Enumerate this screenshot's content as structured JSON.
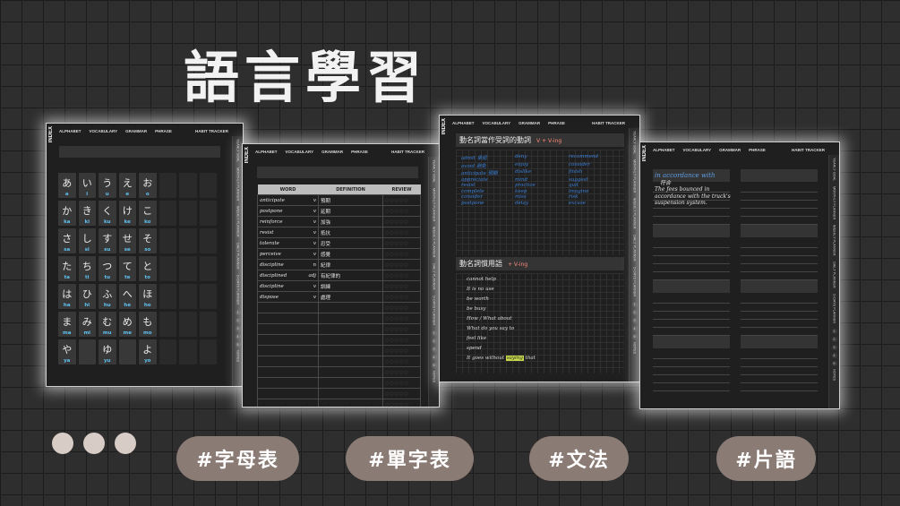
{
  "title": "語言學習",
  "nav": {
    "items": [
      "ALPHABET",
      "VOCABULARY",
      "GRAMMAR",
      "PHRASE"
    ],
    "tracker": "HABIT TRACKER",
    "index": "INDEX"
  },
  "sidetabs": [
    "YEARLY GOAL",
    "MONTHLY PLANNER",
    "WEEKLY PLANNER",
    "DAILY PLANNER",
    "D-DAYS PLANNER"
  ],
  "sidetab_numbers": [
    "1",
    "2",
    "3",
    "4",
    "5"
  ],
  "sidetab_notes": "NOTES",
  "kana": [
    [
      {
        "k": "あ",
        "r": "a"
      },
      {
        "k": "い",
        "r": "i"
      },
      {
        "k": "う",
        "r": "u"
      },
      {
        "k": "え",
        "r": "e"
      },
      {
        "k": "お",
        "r": "o"
      }
    ],
    [
      {
        "k": "か",
        "r": "ka"
      },
      {
        "k": "き",
        "r": "ki"
      },
      {
        "k": "く",
        "r": "ku"
      },
      {
        "k": "け",
        "r": "ke"
      },
      {
        "k": "こ",
        "r": "ko"
      }
    ],
    [
      {
        "k": "さ",
        "r": "sa"
      },
      {
        "k": "し",
        "r": "si"
      },
      {
        "k": "す",
        "r": "su"
      },
      {
        "k": "せ",
        "r": "se"
      },
      {
        "k": "そ",
        "r": "so"
      }
    ],
    [
      {
        "k": "た",
        "r": "ta"
      },
      {
        "k": "ち",
        "r": "ti"
      },
      {
        "k": "つ",
        "r": "tu"
      },
      {
        "k": "て",
        "r": "te"
      },
      {
        "k": "と",
        "r": "to"
      }
    ],
    [
      {
        "k": "は",
        "r": "ha"
      },
      {
        "k": "ひ",
        "r": "hi"
      },
      {
        "k": "ふ",
        "r": "hu"
      },
      {
        "k": "へ",
        "r": "he"
      },
      {
        "k": "ほ",
        "r": "ho"
      }
    ],
    [
      {
        "k": "ま",
        "r": "ma"
      },
      {
        "k": "み",
        "r": "mi"
      },
      {
        "k": "む",
        "r": "mu"
      },
      {
        "k": "め",
        "r": "me"
      },
      {
        "k": "も",
        "r": "mo"
      }
    ],
    [
      {
        "k": "や",
        "r": "ya"
      },
      {
        "k": "",
        "r": ""
      },
      {
        "k": "ゆ",
        "r": "yu"
      },
      {
        "k": "",
        "r": ""
      },
      {
        "k": "よ",
        "r": "yo"
      }
    ]
  ],
  "vocab": {
    "headers": [
      "WORD",
      "DEFINITION",
      "REVIEW"
    ],
    "rows": [
      {
        "word": "anticipate",
        "pos": "v",
        "def": "預期"
      },
      {
        "word": "postpone",
        "pos": "v",
        "def": "延期"
      },
      {
        "word": "reinforce",
        "pos": "v",
        "def": "加強"
      },
      {
        "word": "resist",
        "pos": "v",
        "def": "抵抗"
      },
      {
        "word": "tolerate",
        "pos": "v",
        "def": "忍受"
      },
      {
        "word": "perceive",
        "pos": "v",
        "def": "感覺"
      },
      {
        "word": "discipline",
        "pos": "n",
        "def": "紀律"
      },
      {
        "word": "disciplined",
        "pos": "adj",
        "def": "有紀律的"
      },
      {
        "word": "discipline",
        "pos": "v",
        "def": "訓練"
      },
      {
        "word": "dispose",
        "pos": "v",
        "def": "處理"
      }
    ]
  },
  "grammar": {
    "heading1": "動名詞當作受詞的動詞",
    "heading1_accent": "V + V-ing",
    "heading2": "動名詞慣用語",
    "heading2_accent": "+ V-ing",
    "words": [
      "admit 承認",
      "deny",
      "recommend",
      "avoid 避免",
      "enjoy",
      "consider",
      "anticipate 預期",
      "dislike",
      "finish",
      "appreciate",
      "mind",
      "suggest",
      "resist",
      "practice",
      "quit",
      "complete",
      "keep",
      "imagine",
      "consider",
      "miss",
      "risk",
      "postpone",
      "delay",
      "excuse"
    ],
    "phrases": [
      "cannot help",
      "It is no use",
      "be worth",
      "be busy",
      "How / What about",
      "What do you say to",
      "feel like",
      "spend",
      "It goes without saying that"
    ],
    "highlight": "saying"
  },
  "phrase": {
    "entry_en": "in accordance with",
    "entry_zh": "符合",
    "example": "The fees bounced in accordance with the truck's suspension system."
  },
  "tags": [
    "#字母表",
    "#單字表",
    "#文法",
    "#片語"
  ]
}
